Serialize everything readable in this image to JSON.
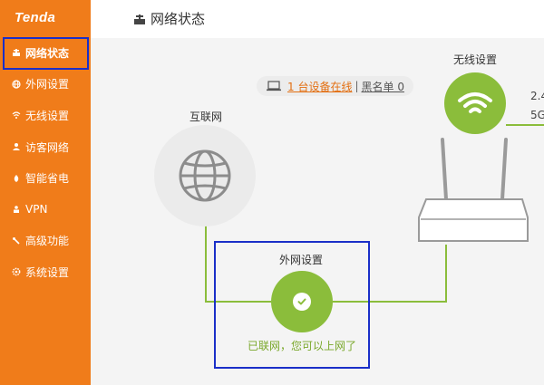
{
  "brand": "Tenda",
  "sidebar": {
    "items": [
      {
        "label": "网络状态",
        "icon": "network-status-icon",
        "active": true
      },
      {
        "label": "外网设置",
        "icon": "globe-icon"
      },
      {
        "label": "无线设置",
        "icon": "wifi-icon"
      },
      {
        "label": "访客网络",
        "icon": "guest-icon"
      },
      {
        "label": "智能省电",
        "icon": "power-save-icon"
      },
      {
        "label": "VPN",
        "icon": "vpn-icon"
      },
      {
        "label": "高级功能",
        "icon": "tools-icon"
      },
      {
        "label": "系统设置",
        "icon": "gear-icon"
      }
    ]
  },
  "header": {
    "title": "网络状态"
  },
  "devices": {
    "online_link": "1 台设备在线",
    "separator": "|",
    "blacklist": "黑名单 0"
  },
  "internet": {
    "label": "互联网"
  },
  "wireless": {
    "label": "无线设置",
    "band_24": "2.4",
    "band_5": "5G"
  },
  "wan": {
    "label": "外网设置",
    "status": "已联网，您可以上网了"
  },
  "colors": {
    "sidebar": "#f07c1a",
    "accent_green": "#8bbd3b",
    "highlight_box": "#1a2fc8",
    "link": "#e36f12"
  }
}
